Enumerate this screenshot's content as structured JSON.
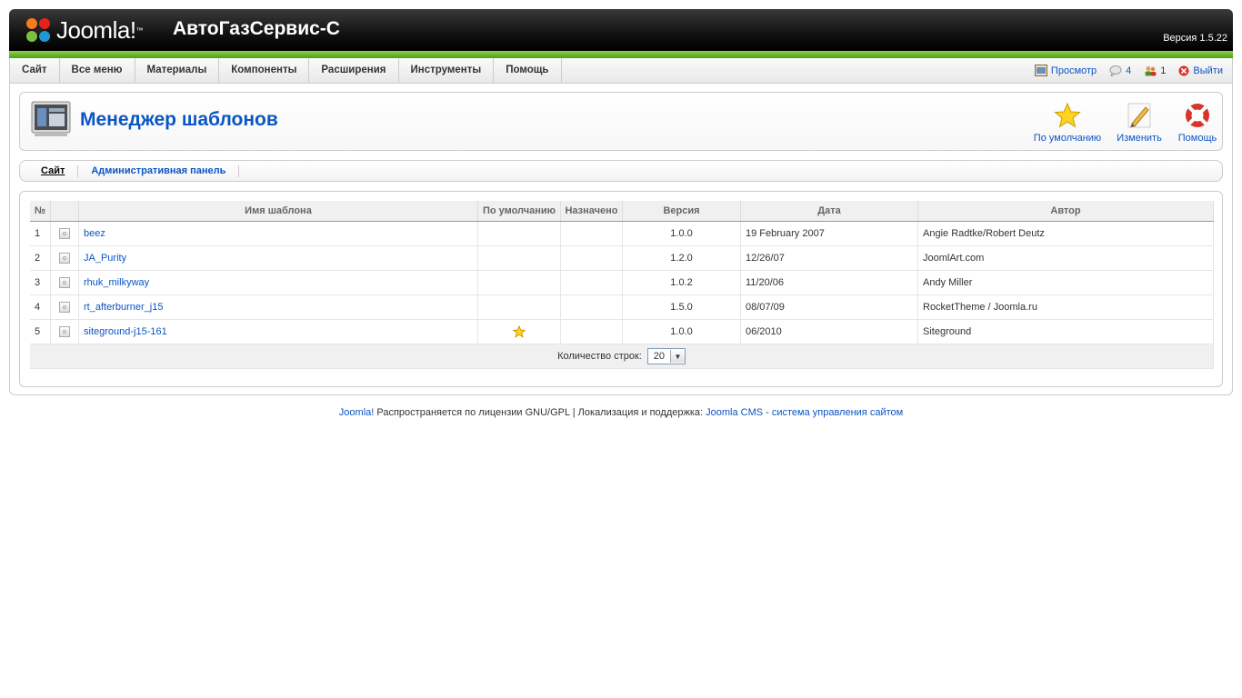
{
  "header": {
    "logo_text": "Joomla!",
    "site_name": "АвтоГазСервис-С",
    "version": "Версия 1.5.22"
  },
  "menu": [
    "Сайт",
    "Все меню",
    "Материалы",
    "Компоненты",
    "Расширения",
    "Инструменты",
    "Помощь"
  ],
  "status": {
    "preview": "Просмотр",
    "messages": "4",
    "users": "1",
    "logout": "Выйти"
  },
  "toolbar": {
    "title": "Менеджер шаблонов",
    "default": "По умолчанию",
    "edit": "Изменить",
    "help": "Помощь"
  },
  "submenu": [
    "Сайт",
    "Административная панель"
  ],
  "table": {
    "headers": {
      "num": "№",
      "name": "Имя шаблона",
      "default": "По умолчанию",
      "assigned": "Назначено",
      "version": "Версия",
      "date": "Дата",
      "author": "Автор"
    },
    "rows": [
      {
        "num": "1",
        "name": "beez",
        "default": false,
        "version": "1.0.0",
        "date": "19 February 2007",
        "author": "Angie Radtke/Robert Deutz"
      },
      {
        "num": "2",
        "name": "JA_Purity",
        "default": false,
        "version": "1.2.0",
        "date": "12/26/07",
        "author": "JoomlArt.com"
      },
      {
        "num": "3",
        "name": "rhuk_milkyway",
        "default": false,
        "version": "1.0.2",
        "date": "11/20/06",
        "author": "Andy Miller"
      },
      {
        "num": "4",
        "name": "rt_afterburner_j15",
        "default": false,
        "version": "1.5.0",
        "date": "08/07/09",
        "author": "RocketTheme / Joomla.ru"
      },
      {
        "num": "5",
        "name": "siteground-j15-161",
        "default": true,
        "version": "1.0.0",
        "date": "06/2010",
        "author": "Siteground"
      }
    ],
    "rows_label": "Количество строк:",
    "rows_value": "20"
  },
  "footer": {
    "joomla": "Joomla!",
    "license": " Распространяется по лицензии GNU/GPL | Локализация и поддержка: ",
    "link": "Joomla CMS - система управления сайтом"
  },
  "colors": {
    "accent": "#0b55c4",
    "green": "#6cba2d"
  }
}
